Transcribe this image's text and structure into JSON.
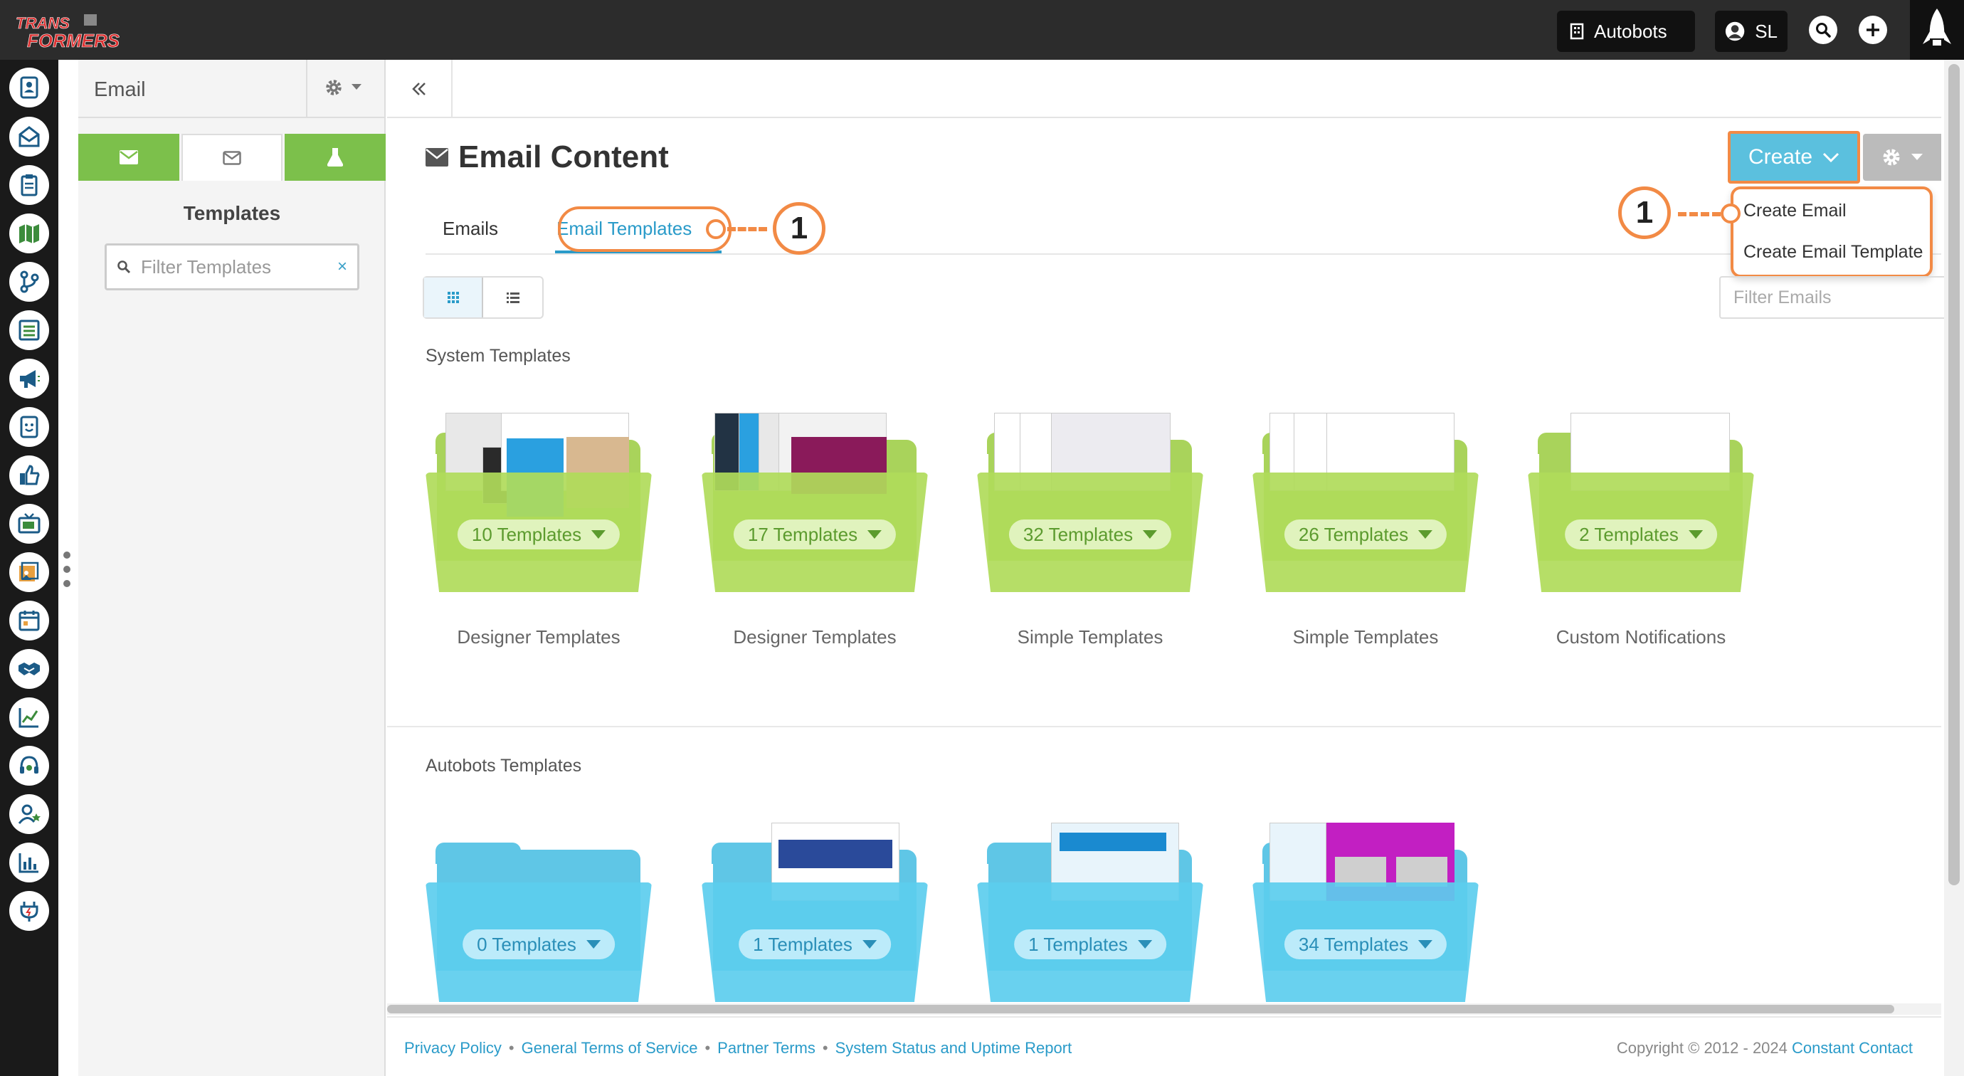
{
  "topbar": {
    "logo_text": "TRANSFORMERS",
    "account_button": "Autobots",
    "user_initials": "SL"
  },
  "rail": {
    "icons": [
      "contacts-icon",
      "email-icon",
      "forms-icon",
      "map-icon",
      "workflow-icon",
      "lists-icon",
      "megaphone-icon",
      "chat-icon",
      "thumbs-up-icon",
      "tv-icon",
      "media-icon",
      "calendar-icon",
      "handshake-icon",
      "chart-icon",
      "support-icon",
      "user-star-icon",
      "analytics-icon",
      "plugin-icon"
    ]
  },
  "sidebar": {
    "title": "Email",
    "section_title": "Templates",
    "filter_placeholder": "Filter Templates",
    "filter_clear": "×"
  },
  "main": {
    "page_title": "Email Content",
    "tabs": [
      {
        "label": "Emails",
        "active": false
      },
      {
        "label": "Email Templates",
        "active": true
      }
    ],
    "create_button": "Create",
    "create_menu": [
      "Create Email",
      "Create Email Template"
    ],
    "filter_emails_placeholder": "Filter Emails",
    "callout_number": "1",
    "system_section": {
      "title": "System Templates",
      "folders": [
        {
          "count": "10 Templates",
          "label": "Designer Templates"
        },
        {
          "count": "17 Templates",
          "label": "Designer Templates"
        },
        {
          "count": "32 Templates",
          "label": "Simple Templates"
        },
        {
          "count": "26 Templates",
          "label": "Simple Templates"
        },
        {
          "count": "2 Templates",
          "label": "Custom Notifications"
        }
      ]
    },
    "autobots_section": {
      "title": "Autobots Templates",
      "folders": [
        {
          "count": "0 Templates"
        },
        {
          "count": "1 Templates"
        },
        {
          "count": "1 Templates"
        },
        {
          "count": "34 Templates"
        }
      ]
    }
  },
  "footer": {
    "links": [
      "Privacy Policy",
      "General Terms of Service",
      "Partner Terms",
      "System Status and Uptime Report"
    ],
    "separator": "•",
    "copyright": "Copyright © 2012 - 2024",
    "brand_link": "Constant Contact"
  },
  "colors": {
    "accent": "#2a9bc9",
    "create_button": "#5bc0de",
    "highlight": "#f28a45",
    "green_tab": "#7cc04b",
    "system_folder": "#a9d35b",
    "custom_folder": "#5fc6e6"
  }
}
